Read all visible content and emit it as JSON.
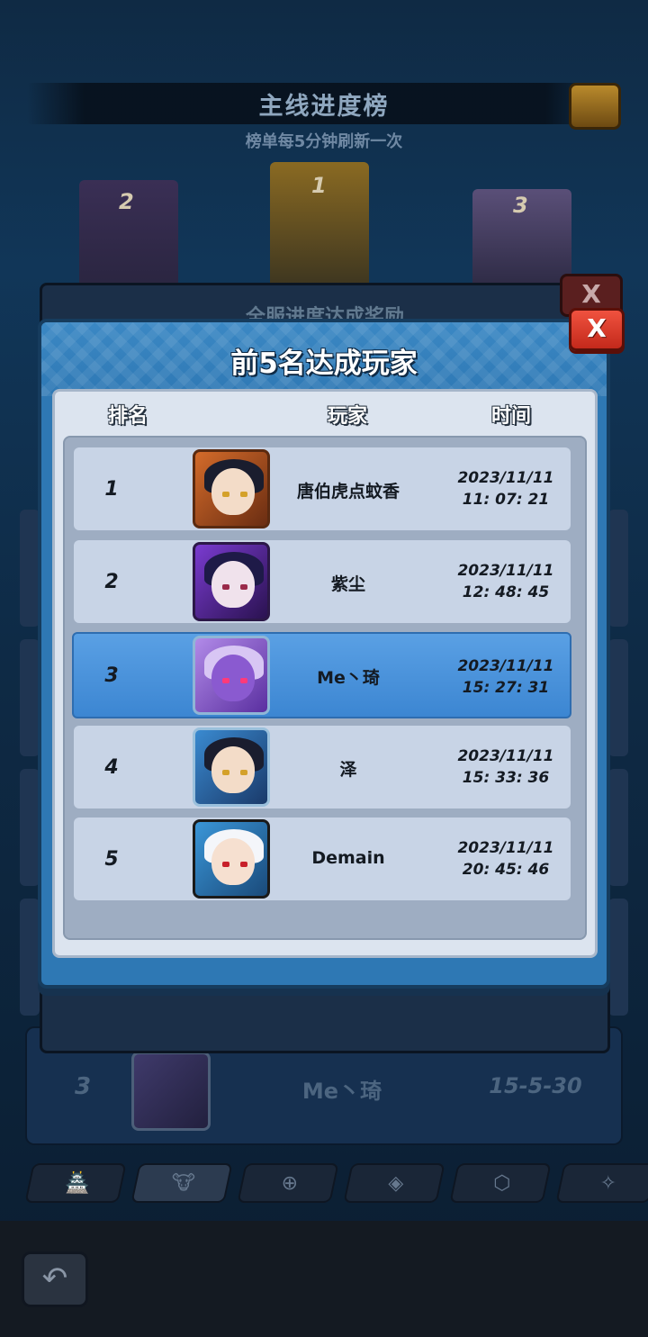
{
  "background": {
    "title": "主线进度榜",
    "subtitle": "榜单每5分钟刷新一次",
    "podium_ranks": [
      "2",
      "1",
      "3"
    ],
    "mid_panel_title": "全服进度达成奖励",
    "close_label": "X",
    "row": {
      "rank": "3",
      "name": "Me丶琦",
      "score": "15-5-30"
    },
    "tab_icons": [
      "🏯",
      "🐮",
      "⊕",
      "◈",
      "⬡",
      "✧"
    ]
  },
  "modal": {
    "title": "前5名达成玩家",
    "close_label": "X",
    "columns": {
      "rank": "排名",
      "player": "玩家",
      "time": "时间"
    },
    "rows": [
      {
        "rank": "1",
        "name": "唐伯虎点蚊香",
        "date": "2023/11/11",
        "clock": "11: 07: 21",
        "avatar": "dark-haired-girl-orange-frame-icon"
      },
      {
        "rank": "2",
        "name": "紫尘",
        "date": "2023/11/11",
        "clock": "12: 48: 45",
        "avatar": "purple-haired-girl-purple-frame-icon"
      },
      {
        "rank": "3",
        "name": "Me丶琦",
        "date": "2023/11/11",
        "clock": "15: 27: 31",
        "avatar": "purple-beast-blue-frame-icon"
      },
      {
        "rank": "4",
        "name": "泽",
        "date": "2023/11/11",
        "clock": "15: 33: 36",
        "avatar": "dark-haired-girl-blue-frame-icon"
      },
      {
        "rank": "5",
        "name": "Demain",
        "date": "2023/11/11",
        "clock": "20: 45: 46",
        "avatar": "white-haired-boy-blue-icon"
      }
    ],
    "highlight_row": "3"
  },
  "colors": {
    "modal_blue": "#2e78b4",
    "highlight_row": "#4a94dc",
    "close_red": "#d93a2a"
  }
}
